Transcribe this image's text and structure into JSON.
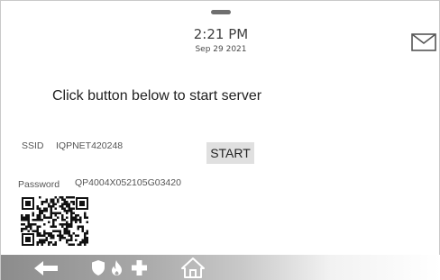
{
  "header": {
    "time": "2:21 PM",
    "date": "Sep 29 2021",
    "mail_icon": "envelope-icon"
  },
  "main": {
    "instruction": "Click button below to start server",
    "ssid_label": "SSID",
    "ssid_value": "IQPNET420248",
    "start_button_label": "START",
    "password_label": "Password",
    "password_value": "QP4004X052105G03420",
    "qr_icon": "qr-code"
  },
  "bottom_bar": {
    "icons": [
      "back-arrow-icon",
      "shield-icon",
      "fire-icon",
      "medical-cross-icon",
      "home-icon"
    ]
  },
  "colors": {
    "text": "#333333",
    "button_background": "#e0e0e0",
    "bar_dark": "#8c8c8c",
    "icon_white": "#ffffff"
  }
}
